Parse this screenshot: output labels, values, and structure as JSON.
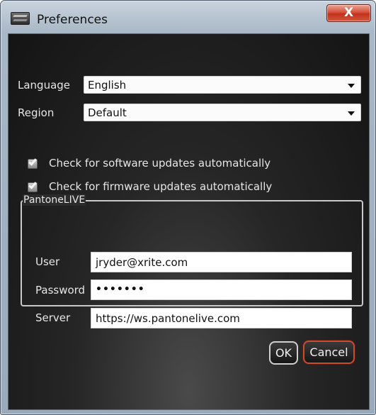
{
  "window": {
    "title": "Preferences",
    "close_label": "X"
  },
  "general": {
    "language_label": "Language",
    "language_value": "English",
    "region_label": "Region",
    "region_value": "Default"
  },
  "checks": [
    {
      "label": "Check for software updates automatically",
      "checked": true
    },
    {
      "label": "Check for firmware updates automatically",
      "checked": true
    }
  ],
  "pantone_live": {
    "title": "PantoneLIVE",
    "user_label": "User",
    "user_value": "jryder@xrite.com",
    "password_label": "Password",
    "password_value": "•••••••",
    "server_label": "Server",
    "server_value": "https://ws.pantonelive.com"
  },
  "buttons": {
    "ok_label": "OK",
    "cancel_label": "Cancel"
  },
  "colors": {
    "background": "#1a1a1a",
    "cancel_border": "#cf4a2a",
    "close_button": "#c3311c"
  },
  "icons": {
    "app": "app-icon",
    "dropdown": "chevron-down-icon",
    "checkbox": "checkmark-icon"
  }
}
